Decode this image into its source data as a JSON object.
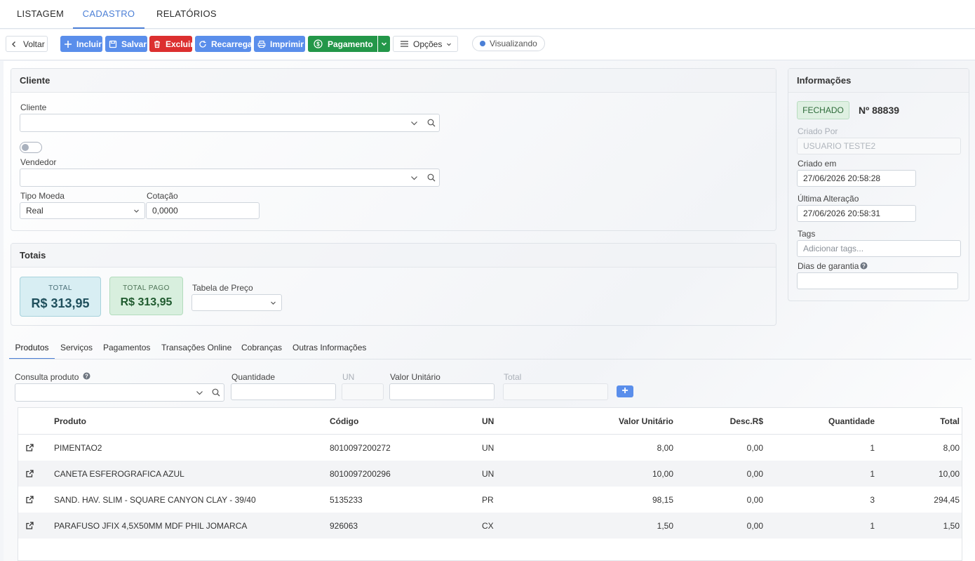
{
  "nav": {
    "tabs": [
      "LISTAGEM",
      "CADASTRO",
      "RELATÓRIOS"
    ]
  },
  "toolbar": {
    "back": "Voltar",
    "include": "Incluir",
    "save": "Salvar",
    "delete": "Excluir",
    "reload": "Recarrega",
    "print": "Imprimir",
    "payment": "Pagamento",
    "options": "Opções",
    "status": "Visualizando"
  },
  "cliente": {
    "title": "Cliente",
    "cliente_label": "Cliente",
    "cliente_value": "",
    "vendedor_label": "Vendedor",
    "vendedor_value": "",
    "tipo_moeda_label": "Tipo Moeda",
    "tipo_moeda_value": "Real",
    "cotacao_label": "Cotação",
    "cotacao_value": "0,0000"
  },
  "totais": {
    "title": "Totais",
    "total_label": "TOTAL",
    "total_value": "R$ 313,95",
    "pago_label": "TOTAL PAGO",
    "pago_value": "R$ 313,95",
    "tabela_label": "Tabela de Preço",
    "tabela_value": ""
  },
  "info": {
    "title": "Informações",
    "status": "FECHADO",
    "number": "Nº 88839",
    "criado_por_label": "Criado Por",
    "criado_por_value": "USUARIO TESTE2",
    "criado_em_label": "Criado em",
    "criado_em_value": "27/06/2026 20:58:28",
    "alteracao_label": "Última Alteração",
    "alteracao_value": "27/06/2026 20:58:31",
    "tags_label": "Tags",
    "tags_placeholder": "Adicionar tags...",
    "garantia_label": "Dias de garantia",
    "garantia_value": ""
  },
  "product_tabs": [
    "Produtos",
    "Serviços",
    "Pagamentos",
    "Transações Online",
    "Cobranças",
    "Outras Informações"
  ],
  "entry": {
    "consulta_label": "Consulta produto",
    "quantidade_label": "Quantidade",
    "un_label": "UN",
    "valor_label": "Valor Unitário",
    "total_label": "Total"
  },
  "table": {
    "headers": [
      "Produto",
      "Código",
      "UN",
      "Valor Unitário",
      "Desc.R$",
      "Quantidade",
      "Total"
    ],
    "rows": [
      [
        "PIMENTAO2",
        "8010097200272",
        "UN",
        "8,00",
        "0,00",
        "1",
        "8,00"
      ],
      [
        "CANETA ESFEROGRAFICA AZUL",
        "8010097200296",
        "UN",
        "10,00",
        "0,00",
        "1",
        "10,00"
      ],
      [
        "SAND. HAV. SLIM - SQUARE CANYON CLAY - 39/40",
        "5135233",
        "PR",
        "98,15",
        "0,00",
        "3",
        "294,45"
      ],
      [
        "PARAFUSO JFIX 4,5X50MM MDF PHIL JOMARCA",
        "926063",
        "CX",
        "1,50",
        "0,00",
        "1",
        "1,50"
      ]
    ]
  },
  "colors": {
    "accent": "#5a8eeb",
    "danger": "#dc2f2f",
    "success": "#239749"
  }
}
